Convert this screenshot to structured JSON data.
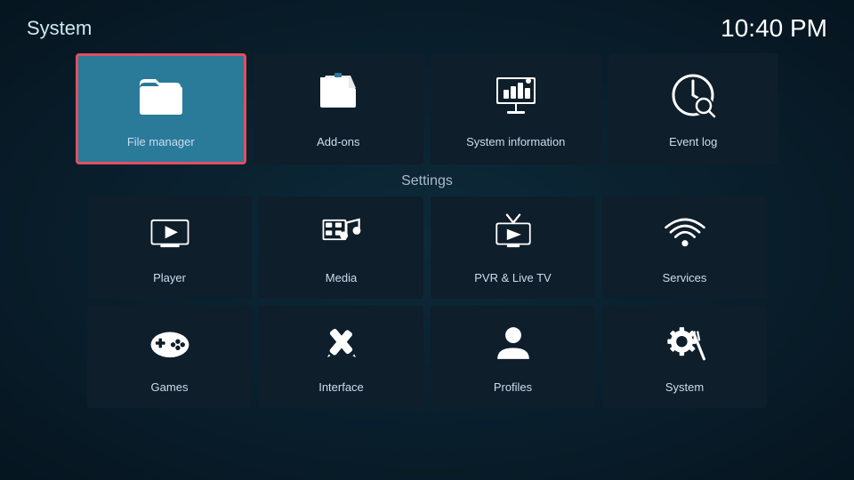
{
  "header": {
    "title": "System",
    "time": "10:40 PM"
  },
  "top_tiles": [
    {
      "id": "file-manager",
      "label": "File manager",
      "selected": true
    },
    {
      "id": "add-ons",
      "label": "Add-ons",
      "selected": false
    },
    {
      "id": "system-information",
      "label": "System information",
      "selected": false
    },
    {
      "id": "event-log",
      "label": "Event log",
      "selected": false
    }
  ],
  "settings_title": "Settings",
  "settings_row1": [
    {
      "id": "player",
      "label": "Player"
    },
    {
      "id": "media",
      "label": "Media"
    },
    {
      "id": "pvr-live-tv",
      "label": "PVR & Live TV"
    },
    {
      "id": "services",
      "label": "Services"
    }
  ],
  "settings_row2": [
    {
      "id": "games",
      "label": "Games"
    },
    {
      "id": "interface",
      "label": "Interface"
    },
    {
      "id": "profiles",
      "label": "Profiles"
    },
    {
      "id": "system",
      "label": "System"
    }
  ]
}
